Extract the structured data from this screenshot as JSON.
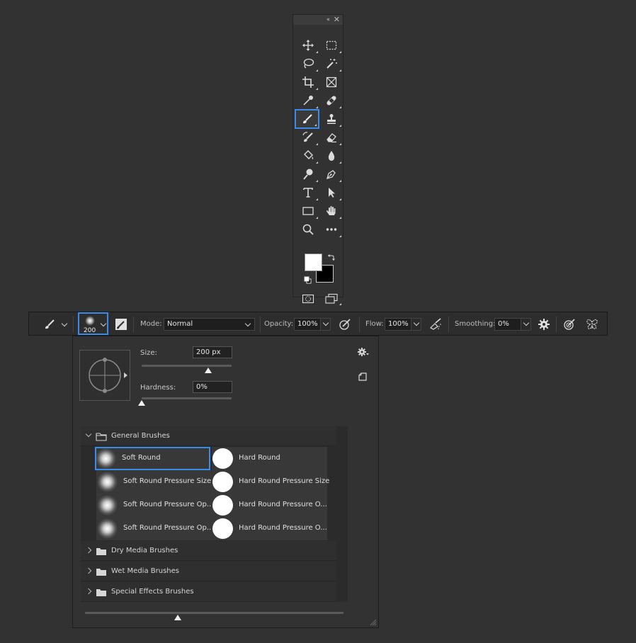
{
  "toolbox": {
    "collapse_glyph": "‹‹",
    "close_glyph": "✕",
    "tools": [
      [
        "move-tool",
        "marquee-tool"
      ],
      [
        "lasso-tool",
        "magic-wand-tool"
      ],
      [
        "crop-tool",
        "frame-tool"
      ],
      [
        "eyedropper-tool",
        "healing-brush-tool"
      ],
      [
        "brush-tool",
        "clone-stamp-tool"
      ],
      [
        "history-brush-tool",
        "eraser-tool"
      ],
      [
        "paint-bucket-tool",
        "blur-tool"
      ],
      [
        "dodge-tool",
        "pen-tool"
      ],
      [
        "type-tool",
        "path-selection-tool"
      ],
      [
        "rectangle-tool",
        "hand-tool"
      ],
      [
        "zoom-tool",
        "more-tools"
      ]
    ],
    "active_tool": "brush-tool",
    "colors": {
      "foreground": "#ffffff",
      "background": "#000000"
    }
  },
  "options_bar": {
    "brush_size_value": "200",
    "mode_label": "Mode:",
    "mode_value": "Normal",
    "opacity_label": "Opacity:",
    "opacity_value": "100%",
    "flow_label": "Flow:",
    "flow_value": "100%",
    "smoothing_label": "Smoothing:",
    "smoothing_value": "0%"
  },
  "brush_picker": {
    "size_label": "Size:",
    "size_value": "200 px",
    "size_fraction": 0.74,
    "hardness_label": "Hardness:",
    "hardness_value": "0%",
    "hardness_fraction": 0.0,
    "groups": [
      {
        "name": "General Brushes",
        "expanded": true,
        "brushes": [
          [
            {
              "name": "Soft Round",
              "type": "soft",
              "selected": true
            },
            {
              "name": "Hard Round",
              "type": "hard"
            }
          ],
          [
            {
              "name": "Soft Round Pressure Size",
              "type": "soft"
            },
            {
              "name": "Hard Round Pressure Size",
              "type": "hard"
            }
          ],
          [
            {
              "name": "Soft Round Pressure Op...",
              "type": "soft"
            },
            {
              "name": "Hard Round Pressure O...",
              "type": "hard"
            }
          ],
          [
            {
              "name": "Soft Round Pressure Op...",
              "type": "soft"
            },
            {
              "name": "Hard Round Pressure O...",
              "type": "hard"
            }
          ]
        ]
      },
      {
        "name": "Dry Media Brushes",
        "expanded": false
      },
      {
        "name": "Wet Media Brushes",
        "expanded": false
      },
      {
        "name": "Special Effects Brushes",
        "expanded": false
      }
    ],
    "thumbnail_size_fraction": 0.36
  },
  "accent_color": "#3b8beb"
}
